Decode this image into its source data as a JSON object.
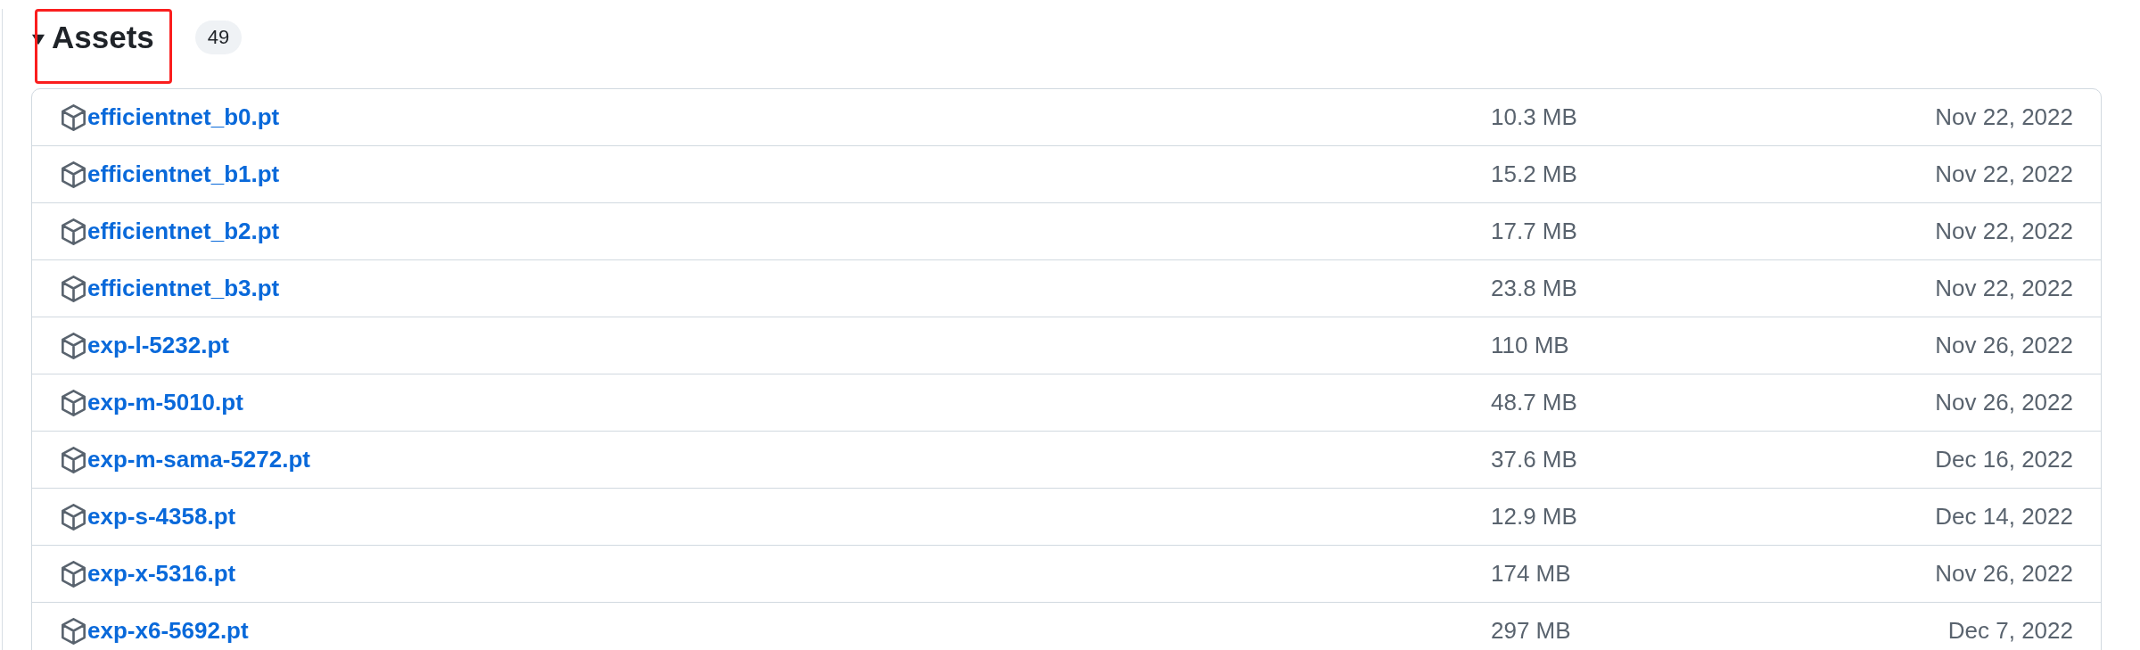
{
  "assets": {
    "title": "Assets",
    "count": "49",
    "expanded": true,
    "highlighted": true,
    "items": [
      {
        "name": "efficientnet_b0.pt",
        "size": "10.3 MB",
        "date": "Nov 22, 2022"
      },
      {
        "name": "efficientnet_b1.pt",
        "size": "15.2 MB",
        "date": "Nov 22, 2022"
      },
      {
        "name": "efficientnet_b2.pt",
        "size": "17.7 MB",
        "date": "Nov 22, 2022"
      },
      {
        "name": "efficientnet_b3.pt",
        "size": "23.8 MB",
        "date": "Nov 22, 2022"
      },
      {
        "name": "exp-l-5232.pt",
        "size": "110 MB",
        "date": "Nov 26, 2022"
      },
      {
        "name": "exp-m-5010.pt",
        "size": "48.7 MB",
        "date": "Nov 26, 2022"
      },
      {
        "name": "exp-m-sama-5272.pt",
        "size": "37.6 MB",
        "date": "Dec 16, 2022"
      },
      {
        "name": "exp-s-4358.pt",
        "size": "12.9 MB",
        "date": "Dec 14, 2022"
      },
      {
        "name": "exp-x-5316.pt",
        "size": "174 MB",
        "date": "Nov 26, 2022"
      },
      {
        "name": "exp-x6-5692.pt",
        "size": "297 MB",
        "date": "Dec 7, 2022"
      }
    ]
  }
}
